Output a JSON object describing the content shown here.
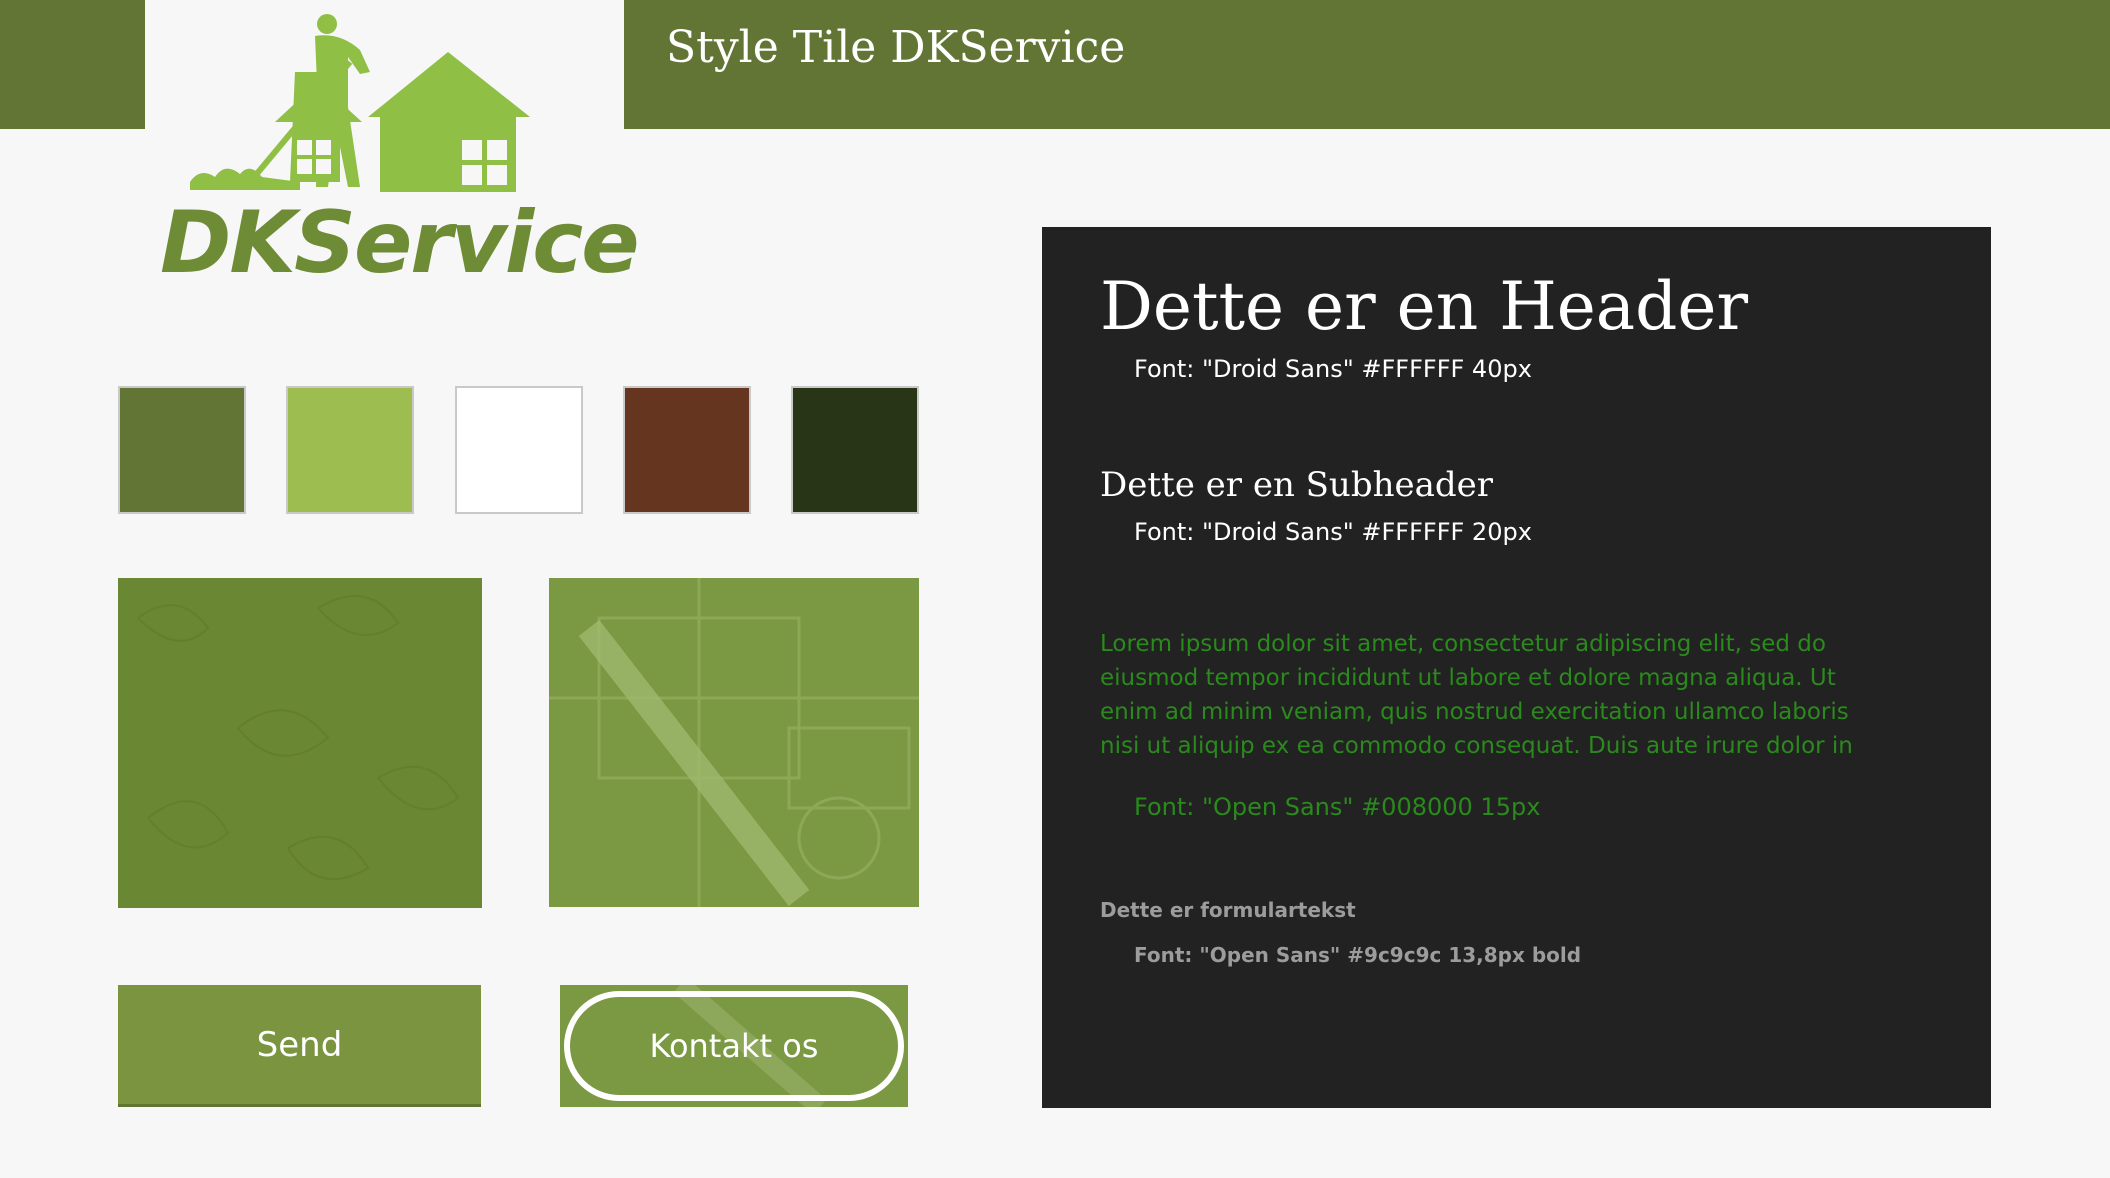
{
  "header": {
    "title": "Style Tile DKService",
    "bar_color": "#627535"
  },
  "logo": {
    "text": "DKService",
    "color": "#6e8c35",
    "icon_color": "#8fbf45"
  },
  "swatches": [
    {
      "name": "olive-green",
      "color": "#627535"
    },
    {
      "name": "light-green",
      "color": "#9dbd50"
    },
    {
      "name": "white",
      "color": "#ffffff"
    },
    {
      "name": "brown",
      "color": "#663520"
    },
    {
      "name": "dark-green",
      "color": "#283517"
    }
  ],
  "textures": [
    {
      "name": "leaf-texture",
      "color": "#6a8733"
    },
    {
      "name": "blueprint-texture",
      "color": "#7b9843"
    }
  ],
  "buttons": {
    "send_label": "Send",
    "contact_label": "Kontakt os"
  },
  "typography": {
    "panel_bg": "#222222",
    "header_sample": "Dette er en Header",
    "header_spec": "Font: \"Droid Sans\" #FFFFFF 40px",
    "subheader_sample": "Dette er en Subheader",
    "subheader_spec": "Font: \"Droid Sans\" #FFFFFF 20px",
    "lorem_lines": [
      "Lorem ipsum dolor sit amet, consectetur adipiscing elit, sed do",
      "eiusmod tempor incididunt ut labore et dolore magna aliqua. Ut",
      "enim ad minim veniam, quis nostrud exercitation ullamco laboris",
      "nisi ut aliquip ex ea commodo consequat. Duis aute irure dolor in"
    ],
    "body_spec": "Font: \"Open Sans\" #008000 15px",
    "form_sample": "Dette er formulartekst",
    "form_spec": "Font: \"Open Sans\" #9c9c9c 13,8px bold"
  }
}
